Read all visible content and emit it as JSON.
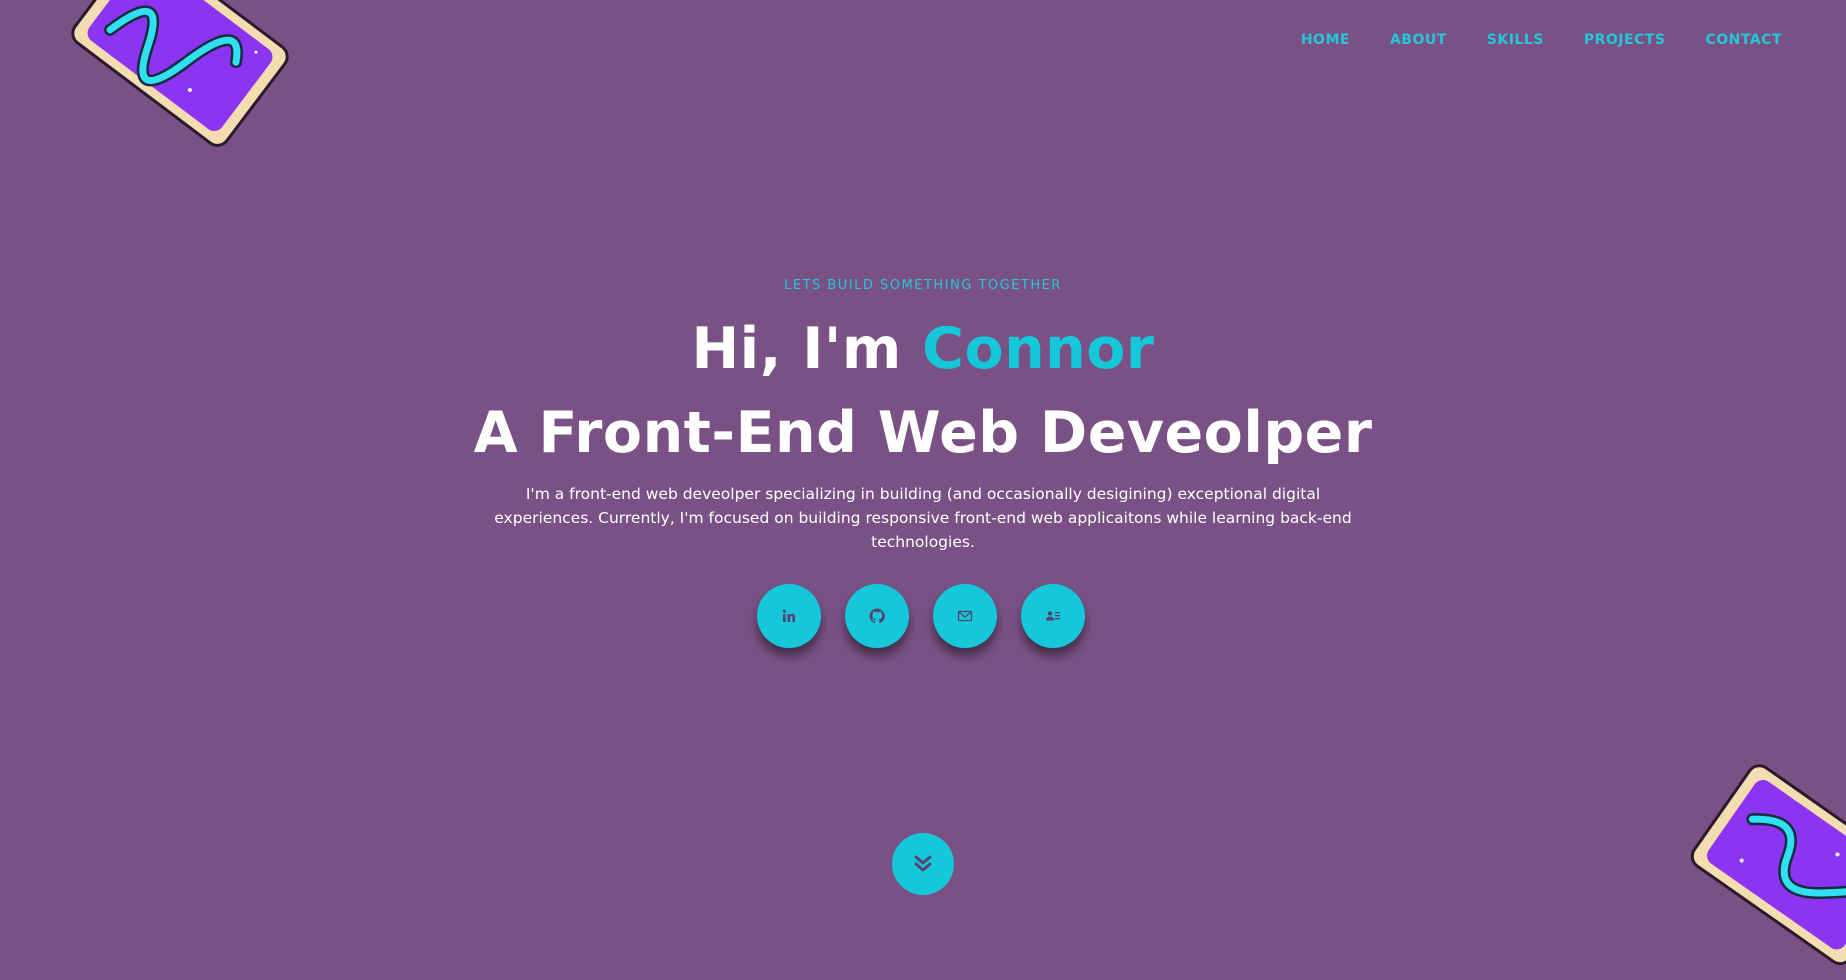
{
  "nav": {
    "items": [
      {
        "label": "HOME"
      },
      {
        "label": "ABOUT"
      },
      {
        "label": "SKILLS"
      },
      {
        "label": "PROJECTS"
      },
      {
        "label": "CONTACT"
      }
    ]
  },
  "hero": {
    "eyebrow": "LETS BUILD SOMETHING TOGETHER",
    "greeting": "Hi, I'm ",
    "name": "Connor",
    "role": "A Front-End Web Deveolper",
    "description": "I'm a front-end web deveolper specializing in building (and occasionally desigining) exceptional digital experiences. Currently, I'm focused on building responsive front-end web applicaitons while learning back-end technologies."
  },
  "socials": [
    {
      "icon": "linkedin-icon"
    },
    {
      "icon": "github-icon"
    },
    {
      "icon": "email-icon"
    },
    {
      "icon": "contact-card-icon"
    }
  ],
  "scroll": {
    "icon": "double-chevron-down-icon"
  },
  "colors": {
    "background": "#7a5185",
    "accent": "#14c8d9",
    "text": "#ffffff",
    "icon": "#5a3f70"
  }
}
